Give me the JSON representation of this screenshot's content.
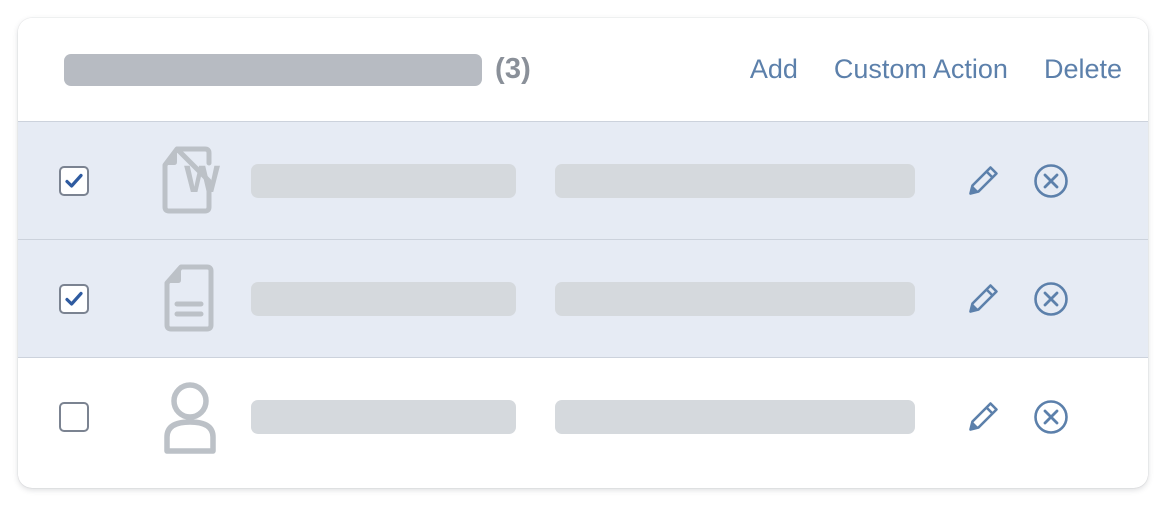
{
  "card": {
    "header": {
      "title_placeholder": "",
      "count_label": "(3)",
      "actions": [
        {
          "name": "add",
          "label": "Add"
        },
        {
          "name": "custom-action",
          "label": "Custom Action"
        },
        {
          "name": "delete",
          "label": "Delete"
        }
      ]
    },
    "rows": [
      {
        "selected": true,
        "checked": true,
        "icon": "word-document-icon",
        "primary_placeholder": "",
        "secondary_placeholder": "",
        "tools": [
          {
            "name": "edit-icon",
            "label": "Edit"
          },
          {
            "name": "remove-circle-icon",
            "label": "Remove"
          }
        ]
      },
      {
        "selected": true,
        "checked": true,
        "icon": "text-document-icon",
        "primary_placeholder": "",
        "secondary_placeholder": "",
        "tools": [
          {
            "name": "edit-icon",
            "label": "Edit"
          },
          {
            "name": "remove-circle-icon",
            "label": "Remove"
          }
        ]
      },
      {
        "selected": false,
        "checked": false,
        "icon": "person-icon",
        "primary_placeholder": "",
        "secondary_placeholder": "",
        "tools": [
          {
            "name": "edit-icon",
            "label": "Edit"
          },
          {
            "name": "remove-circle-icon",
            "label": "Remove"
          }
        ]
      }
    ]
  },
  "colors": {
    "accent_blue": "#5c80ab",
    "check_blue": "#2f5ba0",
    "selected_row_bg": "#e6ebf4",
    "row_bg": "#ffffff",
    "divider": "#ccd2dc",
    "title_placeholder": "#b7bbc2",
    "row_placeholder": "#d5d9dd",
    "icon_gray": "#bcc1c7",
    "checkbox_border": "#7b8391",
    "count_text": "#8a9099"
  }
}
